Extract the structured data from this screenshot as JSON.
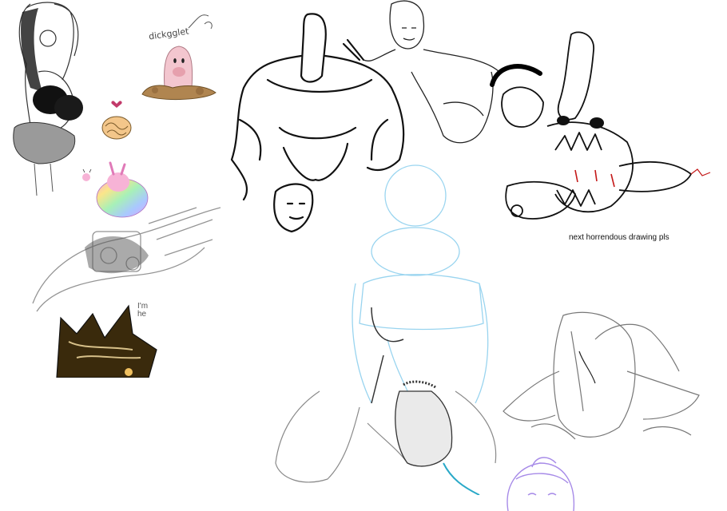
{
  "canvas": {
    "labels": {
      "creature_label": "dickgglet",
      "caption": "next horrendous drawing pls",
      "im_line1": "I'm",
      "im_line2": "he"
    }
  },
  "colors": {
    "ink": "#111111",
    "grey_sketch": "#8a8a8a",
    "light_blue_sketch": "#8fd0ee",
    "purple_sketch": "#a78be8",
    "pink": "#f3c6cf",
    "blood_red": "#c41818",
    "dirt_brown": "#b08550",
    "dark_brown": "#3a2a0c"
  }
}
